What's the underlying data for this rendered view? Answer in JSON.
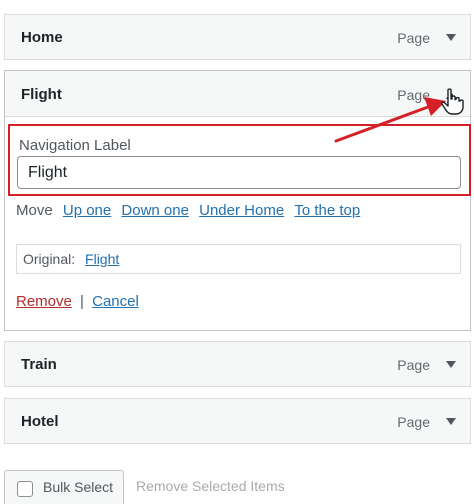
{
  "menu_items": {
    "home": {
      "title": "Home",
      "type": "Page"
    },
    "train": {
      "title": "Train",
      "type": "Page"
    },
    "hotel": {
      "title": "Hotel",
      "type": "Page"
    }
  },
  "flight": {
    "title": "Flight",
    "type": "Page",
    "nav_label_caption": "Navigation Label",
    "nav_label_value": "Flight",
    "move": {
      "label": "Move",
      "up_one": "Up one",
      "down_one": "Down one",
      "under_home": "Under Home",
      "to_top": "To the top"
    },
    "original_label": "Original:",
    "original_link": "Flight",
    "remove": "Remove",
    "separator": "|",
    "cancel": "Cancel"
  },
  "bottom": {
    "bulk_select": "Bulk Select",
    "remove_selected": "Remove Selected Items"
  },
  "colors": {
    "highlight": "#d62027",
    "link": "#2271b1",
    "remove_link": "#b32d2e"
  },
  "icons": {
    "collapse": "triangle-up",
    "expand": "triangle-down",
    "pointer": "hand-cursor",
    "annotation": "red-arrow"
  }
}
